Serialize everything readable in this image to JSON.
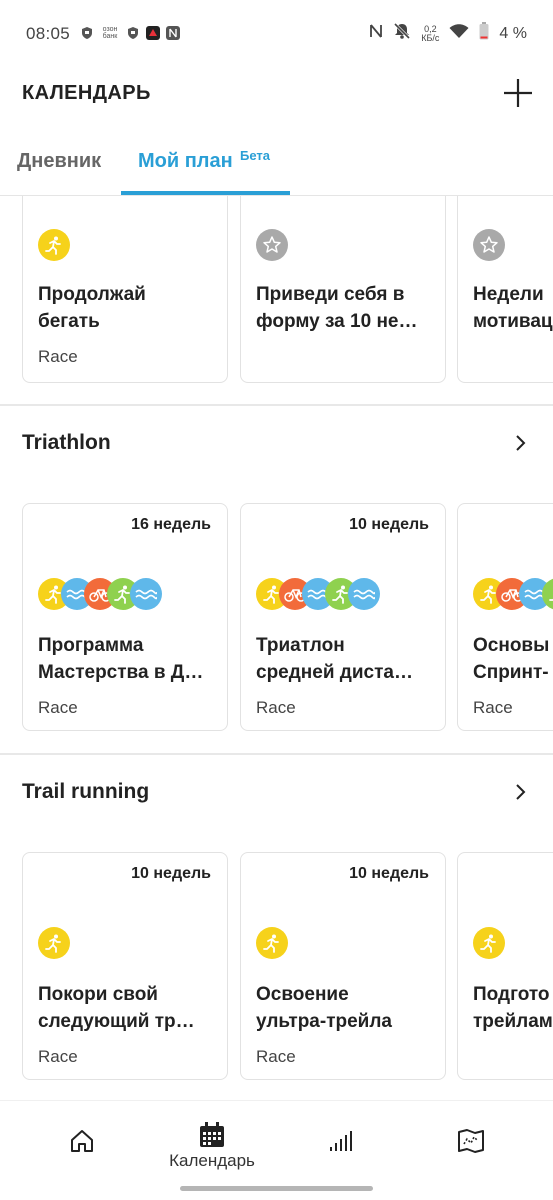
{
  "status_bar": {
    "time": "08:05",
    "left_icons": [
      "shield-icon",
      "bank-icon",
      "shield-icon",
      "app-icon",
      "nfc-icon"
    ],
    "bank_label": "озон банк",
    "net_speed_value": "0,2",
    "net_speed_unit": "КБ/с",
    "battery": "4 %"
  },
  "header": {
    "title": "КАЛЕНДАРЬ",
    "add_icon": "plus-icon"
  },
  "tabs": [
    {
      "label": "Дневник",
      "active": false
    },
    {
      "label": "Мой план",
      "active": true,
      "badge": "Бета"
    }
  ],
  "colors": {
    "accent": "#2a9fd6",
    "run": "#f6d21b",
    "swim": "#5fb8ea",
    "bike": "#f26b3a",
    "trail": "#8fd14f",
    "star": "#a9a9a9"
  },
  "top_cards": [
    {
      "icon": "run-icon",
      "title": "Продолжай\nбегать",
      "tag": "Race"
    },
    {
      "icon": "star-icon",
      "title": "Приведи себя в\nформу за 10 не…",
      "tag": ""
    },
    {
      "icon": "star-icon",
      "title": "Недели\nмотивац",
      "tag": ""
    }
  ],
  "sections": [
    {
      "title": "Triathlon",
      "chevron": "chevron-right-icon",
      "cards": [
        {
          "weeks": "16 недель",
          "icons": [
            "run-icon",
            "swim-icon",
            "bike-icon",
            "trail-run-icon",
            "swim-icon"
          ],
          "title": "Программа\nМастерства в Д…",
          "tag": "Race"
        },
        {
          "weeks": "10 недель",
          "icons": [
            "run-icon",
            "bike-icon",
            "swim-icon",
            "trail-run-icon",
            "swim-icon"
          ],
          "title": "Триатлон\nсредней диста…",
          "tag": "Race"
        },
        {
          "weeks": "",
          "icons": [
            "run-icon",
            "bike-icon",
            "swim-icon",
            "trail-run-icon"
          ],
          "title": "Основы\nСпринт-",
          "tag": "Race"
        }
      ]
    },
    {
      "title": "Trail running",
      "chevron": "chevron-right-icon",
      "cards": [
        {
          "weeks": "10 недель",
          "icons": [
            "run-icon"
          ],
          "title": "Покори свой\nследующий тр…",
          "tag": "Race"
        },
        {
          "weeks": "10 недель",
          "icons": [
            "run-icon"
          ],
          "title": "Освоение\nультра-трейла",
          "tag": "Race"
        },
        {
          "weeks": "",
          "icons": [
            "run-icon"
          ],
          "title": "Подгото\nтрейлам",
          "tag": ""
        }
      ]
    }
  ],
  "bottom_nav": [
    {
      "icon": "home-icon",
      "label": ""
    },
    {
      "icon": "calendar-icon",
      "label": "Календарь"
    },
    {
      "icon": "stats-icon",
      "label": ""
    },
    {
      "icon": "map-icon",
      "label": ""
    }
  ]
}
